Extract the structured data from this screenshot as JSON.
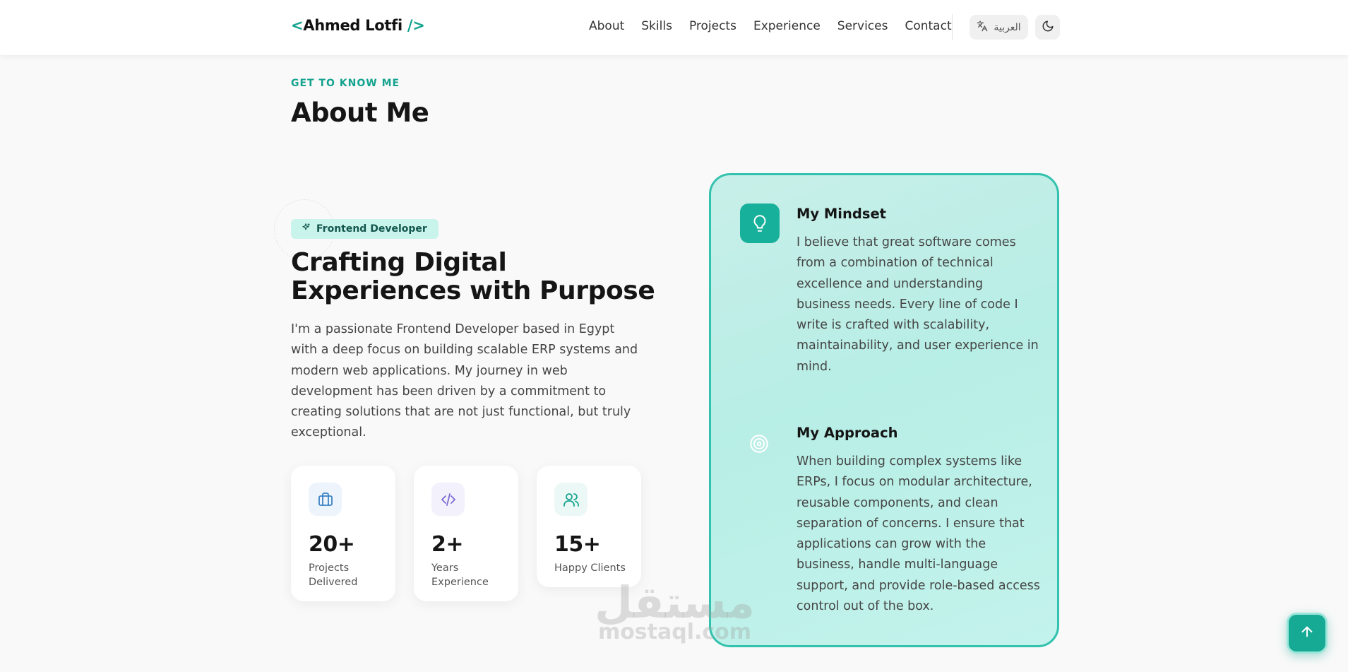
{
  "header": {
    "logo": {
      "open": "<",
      "name": "Ahmed Lotfi",
      "close": " />"
    },
    "nav": [
      "About",
      "Skills",
      "Projects",
      "Experience",
      "Services",
      "Contact"
    ],
    "language_label": "العربية"
  },
  "about": {
    "eyebrow": "GET TO KNOW ME",
    "title": "About Me",
    "role_badge": "Frontend Developer",
    "headline": "Crafting Digital Experiences with Purpose",
    "description": "I'm a passionate Frontend Developer based in Egypt with a deep focus on building scalable ERP systems and modern web applications. My journey in web development has been driven by a commitment to creating solutions that are not just functional, but truly exceptional.",
    "stats": [
      {
        "value": "20+",
        "label": "Projects Delivered",
        "icon": "briefcase-icon"
      },
      {
        "value": "2+",
        "label": "Years Experience",
        "icon": "code-icon"
      },
      {
        "value": "15+",
        "label": "Happy Clients",
        "icon": "users-icon"
      }
    ],
    "mindset": {
      "title": "My Mindset",
      "text": "I believe that great software comes from a combination of technical excellence and understanding business needs. Every line of code I write is crafted with scalability, maintainability, and user experience in mind.",
      "icon": "lightbulb-icon"
    },
    "approach": {
      "title": "My Approach",
      "text": "When building complex systems like ERPs, I focus on modular architecture, reusable components, and clean separation of concerns. I ensure that applications can grow with the business, handle multi-language support, and provide role-based access control out of the box.",
      "icon": "target-icon"
    }
  },
  "watermark": {
    "arabic": "مستقل",
    "latin": "mostaql.com"
  },
  "colors": {
    "accent": "#14a38f",
    "card_border": "#33c2ae",
    "card_bg": "#c3f0e9",
    "badge_bg": "#c9f4ec"
  }
}
